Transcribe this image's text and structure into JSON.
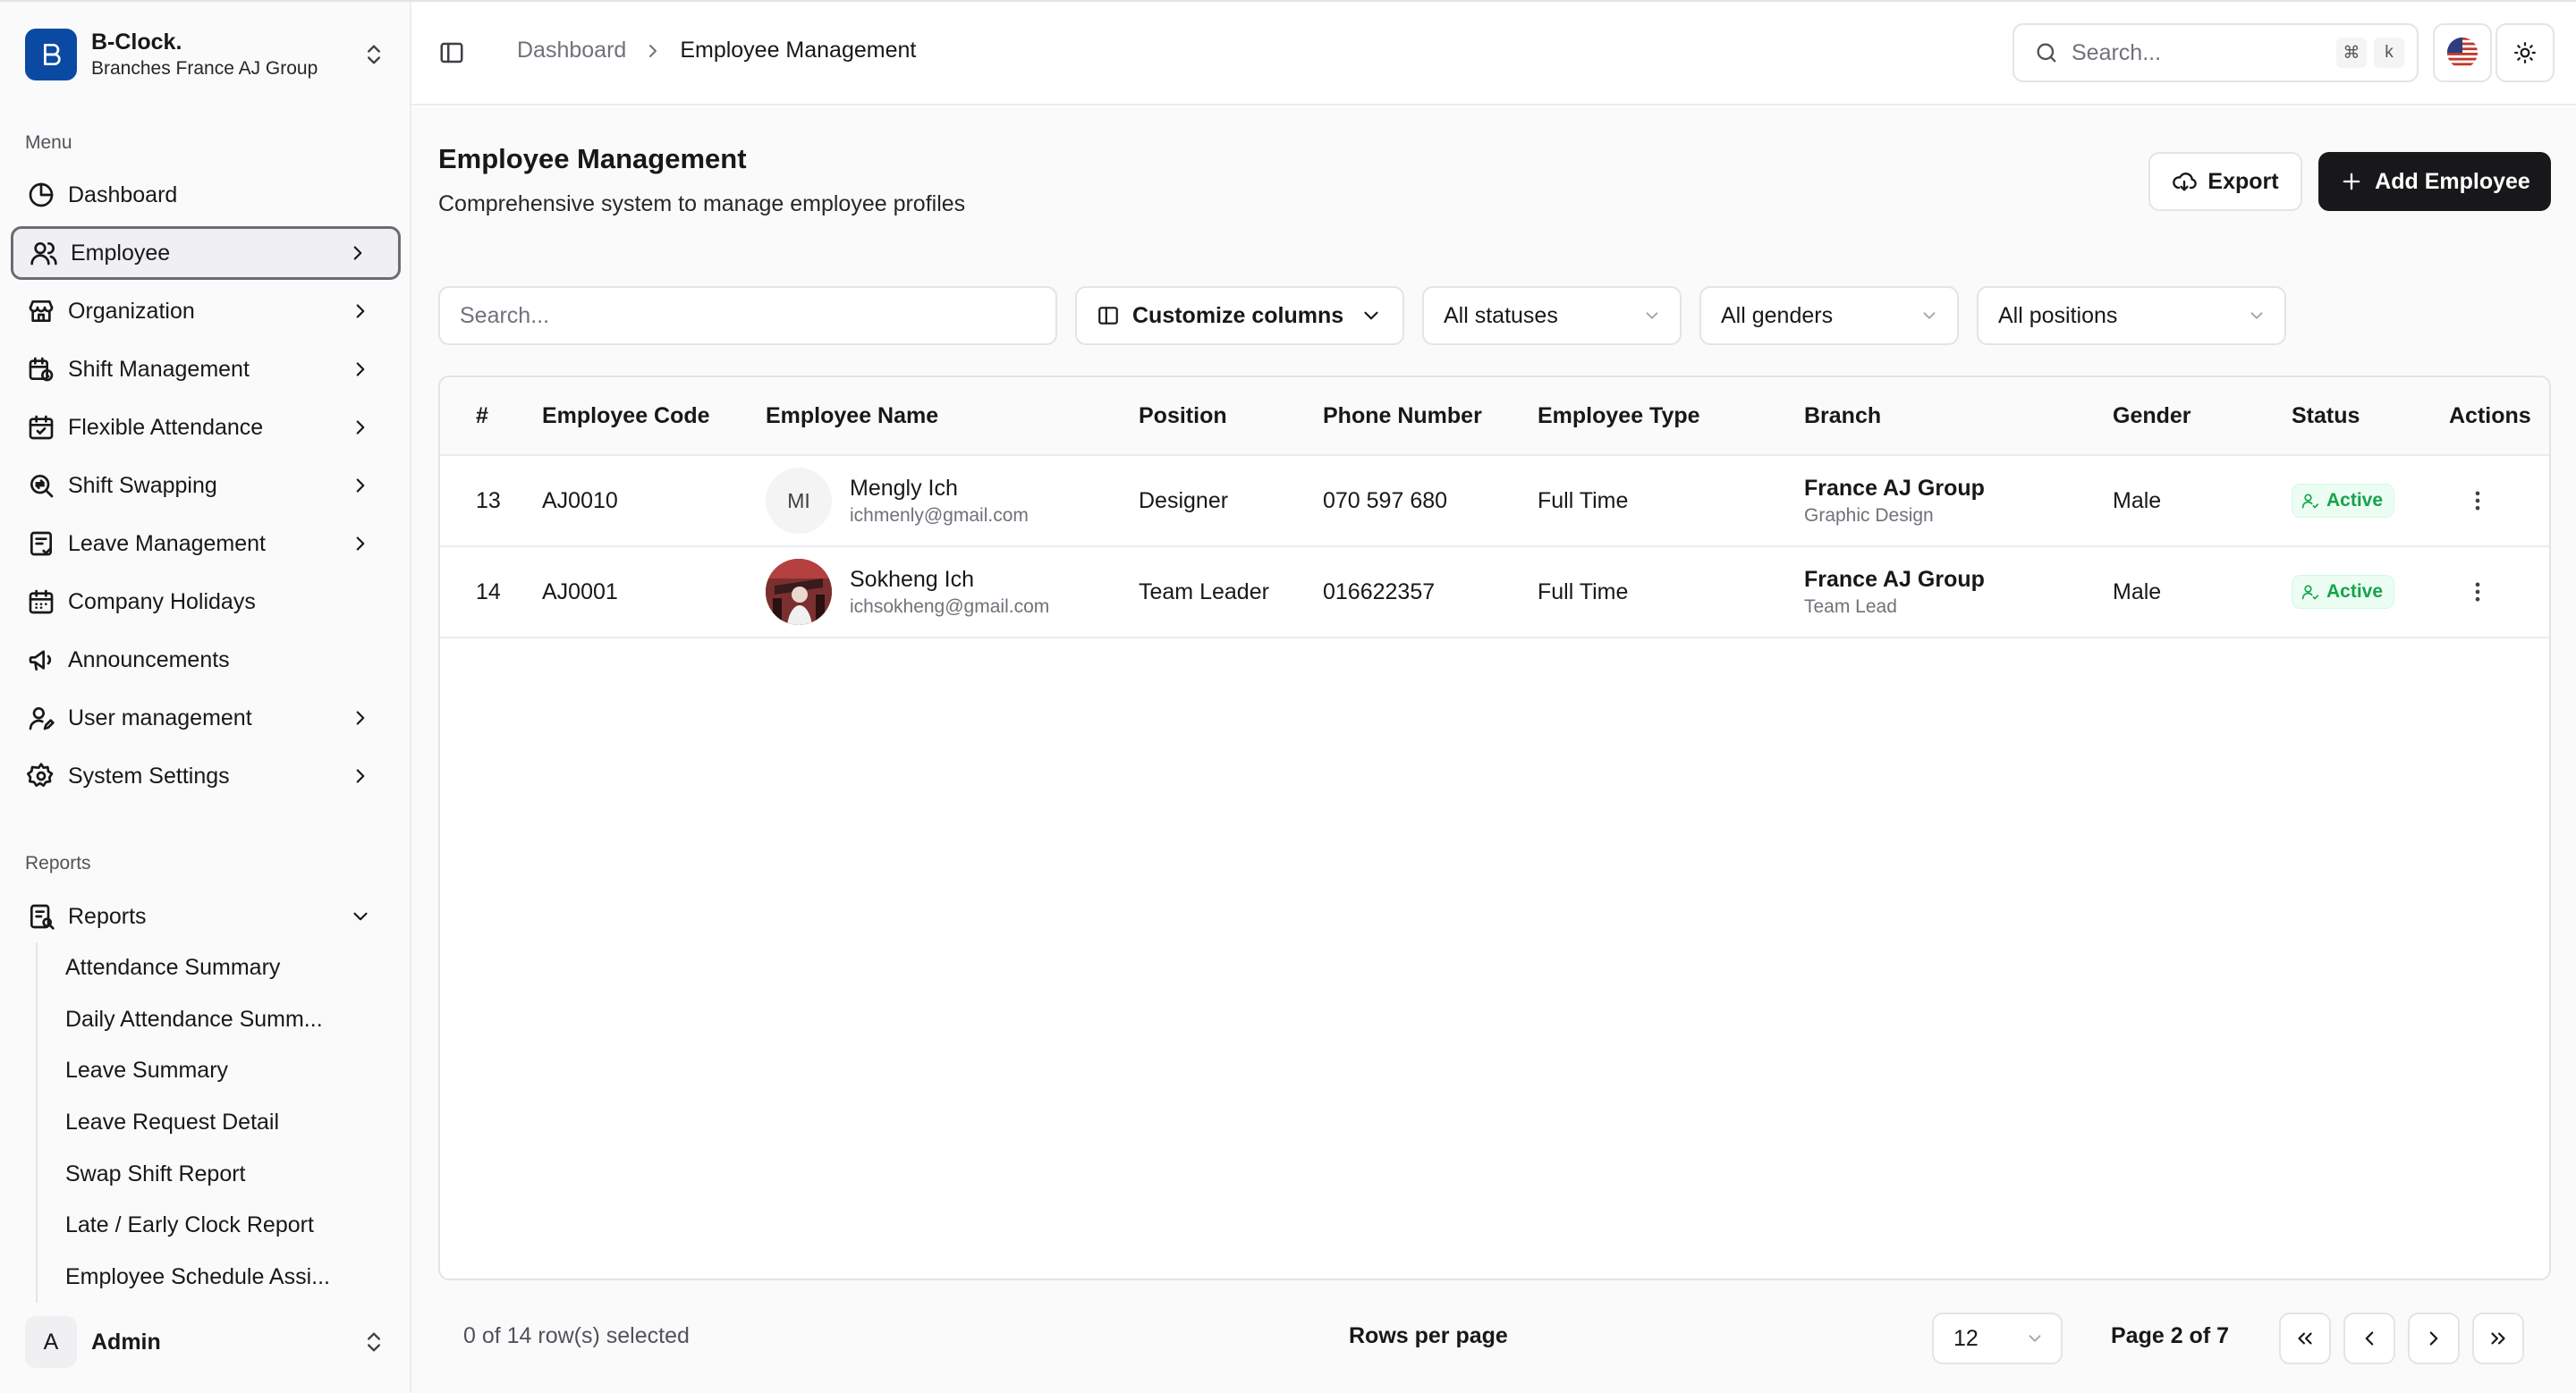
{
  "brand": {
    "name": "B-Clock.",
    "subtitle": "Branches France AJ Group",
    "logo_color": "#0b4aa2"
  },
  "sidebar": {
    "menu_label": "Menu",
    "items": [
      {
        "label": "Dashboard",
        "icon": "pie-chart-icon",
        "has_chevron": false
      },
      {
        "label": "Employee",
        "icon": "users-icon",
        "has_chevron": true,
        "active": true
      },
      {
        "label": "Organization",
        "icon": "store-icon",
        "has_chevron": true
      },
      {
        "label": "Shift Management",
        "icon": "calendar-clock-icon",
        "has_chevron": true
      },
      {
        "label": "Flexible Attendance",
        "icon": "calendar-check-icon",
        "has_chevron": true
      },
      {
        "label": "Shift Swapping",
        "icon": "swap-icon",
        "has_chevron": true
      },
      {
        "label": "Leave Management",
        "icon": "leave-icon",
        "has_chevron": true
      },
      {
        "label": "Company Holidays",
        "icon": "calendar-icon",
        "has_chevron": false
      },
      {
        "label": "Announcements",
        "icon": "megaphone-icon",
        "has_chevron": false
      },
      {
        "label": "User management",
        "icon": "user-pen-icon",
        "has_chevron": true
      },
      {
        "label": "System Settings",
        "icon": "gear-icon",
        "has_chevron": true
      }
    ],
    "reports_label": "Reports",
    "reports_item": {
      "label": "Reports",
      "icon": "report-icon"
    },
    "report_subitems": [
      "Attendance Summary",
      "Daily Attendance Summ...",
      "Leave Summary",
      "Leave Request Detail",
      "Swap Shift Report",
      "Late / Early Clock Report",
      "Employee Schedule Assi..."
    ],
    "user": {
      "initial": "A",
      "name": "Admin"
    }
  },
  "topbar": {
    "breadcrumb": [
      "Dashboard",
      "Employee Management"
    ],
    "search_placeholder": "Search...",
    "shortcut_keys": [
      "⌘",
      "k"
    ]
  },
  "page": {
    "title": "Employee Management",
    "subtitle": "Comprehensive system to manage employee profiles",
    "export_label": "Export",
    "add_label": "Add Employee"
  },
  "filters": {
    "search_placeholder": "Search...",
    "customize_label": "Customize columns",
    "status": "All statuses",
    "gender": "All genders",
    "position": "All positions"
  },
  "table": {
    "columns": [
      "#",
      "Employee Code",
      "Employee Name",
      "Position",
      "Phone Number",
      "Employee Type",
      "Branch",
      "Gender",
      "Status",
      "Actions"
    ],
    "rows": [
      {
        "no": "13",
        "code": "AJ0010",
        "initials": "MI",
        "name": "Mengly Ich",
        "email": "ichmenly@gmail.com",
        "position": "Designer",
        "phone": "070 597 680",
        "type": "Full Time",
        "branch": "France AJ Group",
        "dept": "Graphic Design",
        "gender": "Male",
        "status": "Active"
      },
      {
        "no": "14",
        "code": "AJ0001",
        "initials": "",
        "name": "Sokheng Ich",
        "email": "ichsokheng@gmail.com",
        "position": "Team Leader",
        "phone": "016622357",
        "type": "Full Time",
        "branch": "France AJ Group",
        "dept": "Team Lead",
        "gender": "Male",
        "status": "Active"
      }
    ]
  },
  "footer": {
    "selected": "0 of 14 row(s) selected",
    "rows_per_page_label": "Rows per page",
    "rows_per_page": "12",
    "page_info": "Page 2 of 7"
  },
  "colors": {
    "active_badge": "#16a34a",
    "primary_button": "#18181b"
  }
}
